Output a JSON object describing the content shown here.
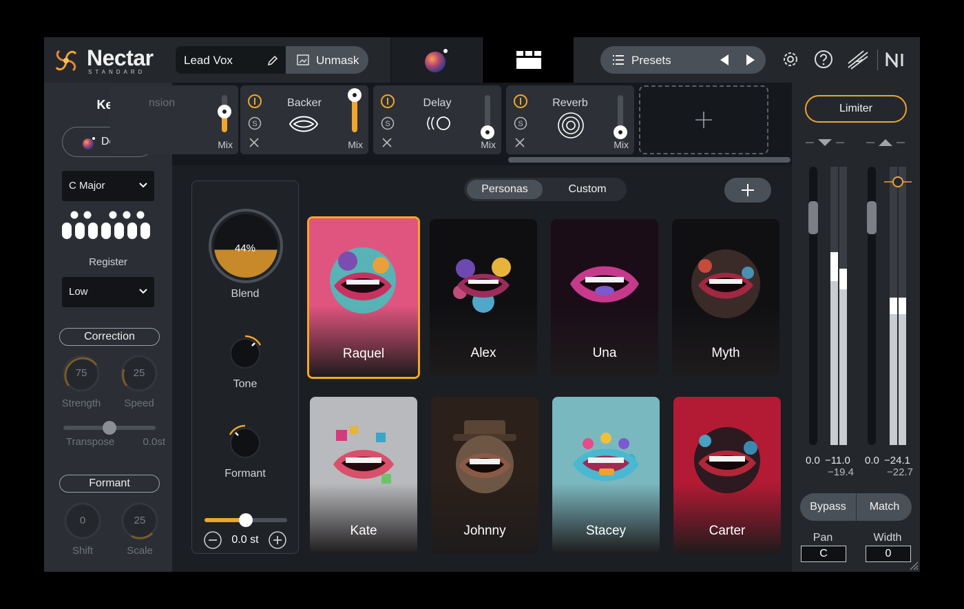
{
  "app": {
    "brand": "Nectar",
    "edition": "STANDARD",
    "preset_name": "Lead Vox",
    "unmask_label": "Unmask",
    "presets_label": "Presets"
  },
  "key_panel": {
    "title": "Key",
    "detect_label": "Detect",
    "scale_value": "C Major",
    "register_label": "Register",
    "register_value": "Low",
    "correction_label": "Correction",
    "strength_value": "75",
    "strength_label": "Strength",
    "speed_value": "25",
    "speed_label": "Speed",
    "transpose_label": "Transpose",
    "transpose_value": "0.0st",
    "formant_label": "Formant",
    "shift_value": "0",
    "shift_label": "Shift",
    "scale_knob_value": "25",
    "scale_knob_label": "Scale"
  },
  "modules": [
    {
      "name": "nsion",
      "mix_label": "Mix",
      "mix_level": 0.55
    },
    {
      "name": "Backer",
      "mix_label": "Mix",
      "mix_level": 1.0
    },
    {
      "name": "Delay",
      "mix_label": "Mix",
      "mix_level": 0.0
    },
    {
      "name": "Reverb",
      "mix_label": "Mix",
      "mix_level": 0.0
    }
  ],
  "blend": {
    "blend_value": "44%",
    "blend_label": "Blend",
    "tone_label": "Tone",
    "formant_label": "Formant",
    "pitch_value": "0.0 st"
  },
  "tabs": {
    "personas": "Personas",
    "custom": "Custom"
  },
  "personas": [
    {
      "name": "Raquel",
      "selected": true,
      "bg": "#e0557f"
    },
    {
      "name": "Alex",
      "selected": false,
      "bg": "#0f0f11"
    },
    {
      "name": "Una",
      "selected": false,
      "bg": "#1a0d18"
    },
    {
      "name": "Myth",
      "selected": false,
      "bg": "#101012"
    },
    {
      "name": "Kate",
      "selected": false,
      "bg": "#b9babd"
    },
    {
      "name": "Johnny",
      "selected": false,
      "bg": "#2b201a"
    },
    {
      "name": "Stacey",
      "selected": false,
      "bg": "#7ab8bf"
    },
    {
      "name": "Carter",
      "selected": false,
      "bg": "#b31a34"
    }
  ],
  "limiter": {
    "label": "Limiter",
    "meter_left_a": "0.0",
    "meter_left_b": "−11.0",
    "meter_left_c": "−19.4",
    "meter_right_a": "0.0",
    "meter_right_b": "−24.1",
    "meter_right_c": "−22.7",
    "bypass_label": "Bypass",
    "match_label": "Match",
    "pan_label": "Pan",
    "pan_value": "C",
    "width_label": "Width",
    "width_value": "0"
  },
  "colors": {
    "accent": "#f0a52c",
    "panel": "#2b2f35",
    "background": "#1d2126"
  }
}
